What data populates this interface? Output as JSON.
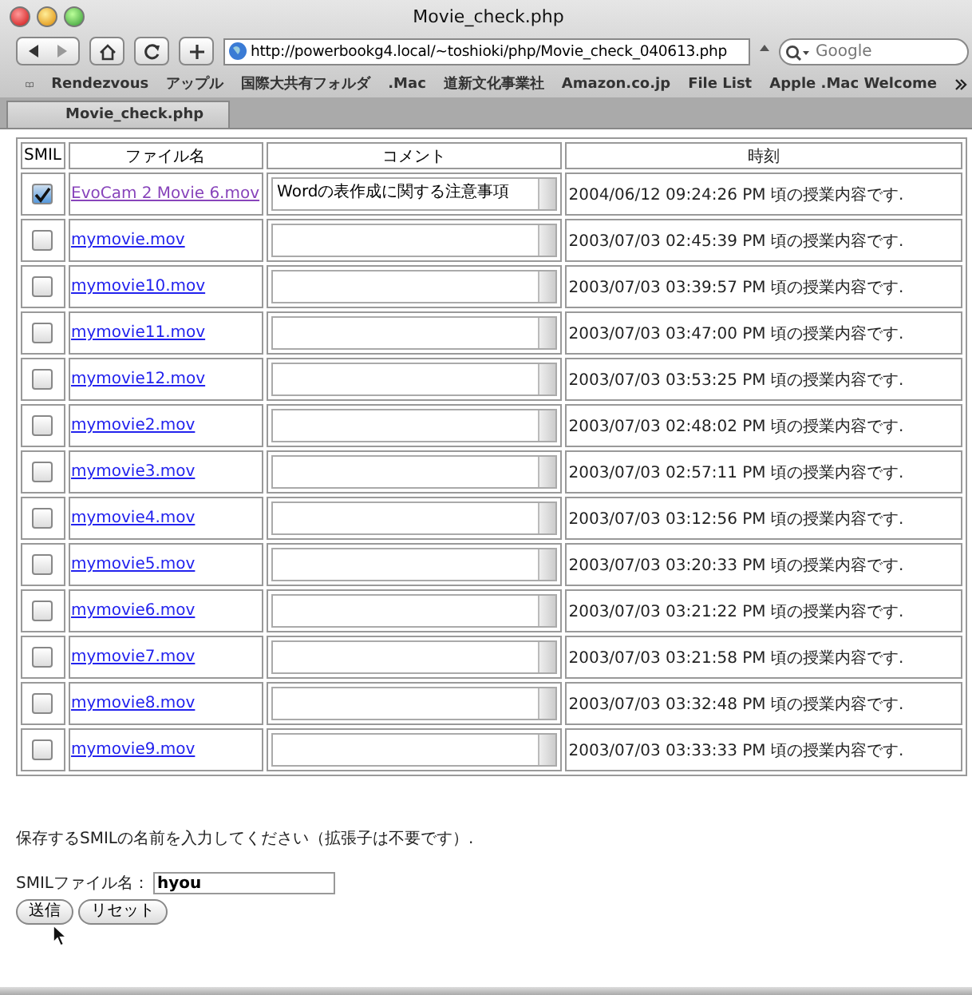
{
  "window": {
    "title": "Movie_check.php"
  },
  "toolbar": {
    "url": "http://powerbookg4.local/~toshioki/php/Movie_check_040613.php",
    "search": {
      "placeholder": "Google"
    }
  },
  "bookmarks": [
    "Rendezvous",
    "アップル",
    "国際大共有フォルダ",
    ".Mac",
    "道新文化事業社",
    "Amazon.co.jp",
    "File List",
    "Apple .Mac Welcome"
  ],
  "tabs": [
    {
      "label": "Movie_check.php",
      "selected": true
    }
  ],
  "table": {
    "columns": [
      "SMIL",
      "ファイル名",
      "コメント",
      "時刻"
    ],
    "rows": [
      {
        "checked": true,
        "file": "EvoCam 2 Movie 6.mov",
        "visited": true,
        "comment": "Wordの表作成に関する注意事項",
        "time": "2004/06/12 09:24:26 PM 頃の授業内容です."
      },
      {
        "checked": false,
        "file": "mymovie.mov",
        "visited": false,
        "time": "2003/07/03 02:45:39 PM 頃の授業内容です."
      },
      {
        "checked": false,
        "file": "mymovie10.mov",
        "visited": false,
        "time": "2003/07/03 03:39:57 PM 頃の授業内容です."
      },
      {
        "checked": false,
        "file": "mymovie11.mov",
        "visited": false,
        "time": "2003/07/03 03:47:00 PM 頃の授業内容です."
      },
      {
        "checked": false,
        "file": "mymovie12.mov",
        "visited": false,
        "time": "2003/07/03 03:53:25 PM 頃の授業内容です."
      },
      {
        "checked": false,
        "file": "mymovie2.mov",
        "visited": false,
        "time": "2003/07/03 02:48:02 PM 頃の授業内容です."
      },
      {
        "checked": false,
        "file": "mymovie3.mov",
        "visited": false,
        "time": "2003/07/03 02:57:11 PM 頃の授業内容です."
      },
      {
        "checked": false,
        "file": "mymovie4.mov",
        "visited": false,
        "time": "2003/07/03 03:12:56 PM 頃の授業内容です."
      },
      {
        "checked": false,
        "file": "mymovie5.mov",
        "visited": false,
        "time": "2003/07/03 03:20:33 PM 頃の授業内容です."
      },
      {
        "checked": false,
        "file": "mymovie6.mov",
        "visited": false,
        "time": "2003/07/03 03:21:22 PM 頃の授業内容です."
      },
      {
        "checked": false,
        "file": "mymovie7.mov",
        "visited": false,
        "time": "2003/07/03 03:21:58 PM 頃の授業内容です."
      },
      {
        "checked": false,
        "file": "mymovie8.mov",
        "visited": false,
        "time": "2003/07/03 03:32:48 PM 頃の授業内容です."
      },
      {
        "checked": false,
        "file": "mymovie9.mov",
        "visited": false,
        "time": "2003/07/03 03:33:33 PM 頃の授業内容です."
      }
    ]
  },
  "form": {
    "instruction": "保存するSMILの名前を入力してください（拡張子は不要です）.",
    "label": "SMILファイル名：",
    "value": "hyou",
    "buttons": [
      "送信",
      "リセット"
    ]
  }
}
